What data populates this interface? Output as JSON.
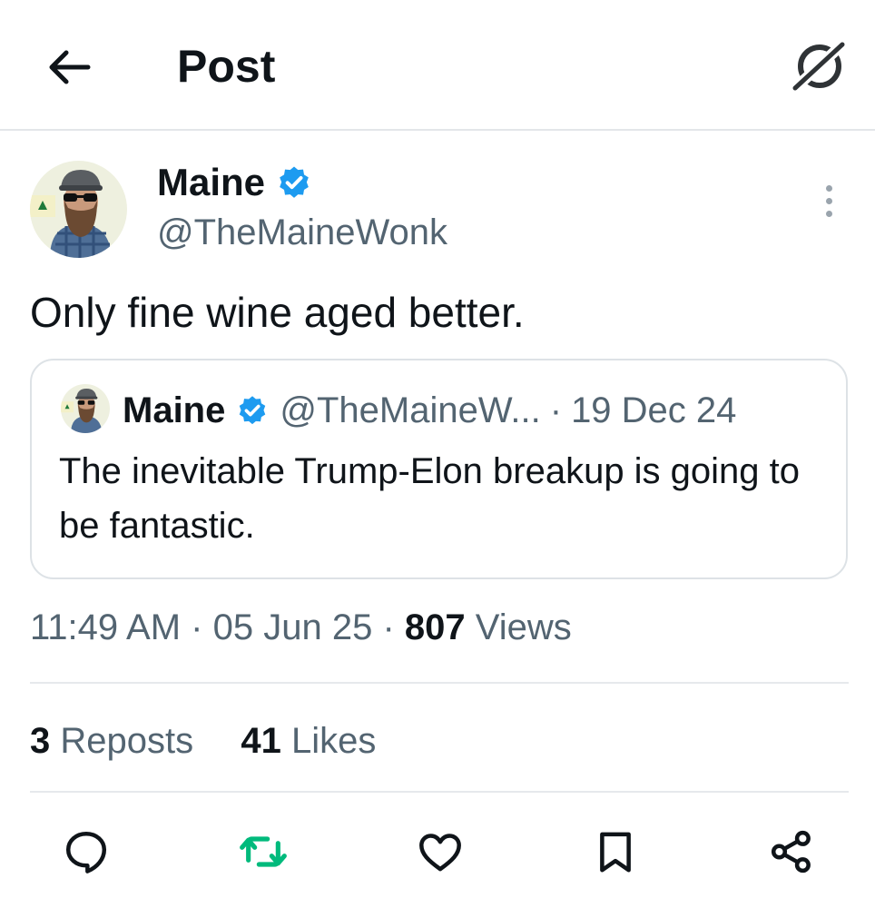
{
  "header": {
    "title": "Post",
    "back_icon": "arrow-left-icon",
    "grok_icon": "grok-icon"
  },
  "author": {
    "name": "Maine",
    "handle": "@TheMaineWonk",
    "verified": true,
    "verified_color": "#1d9bf0"
  },
  "post": {
    "text": "Only fine wine aged better."
  },
  "quote": {
    "name": "Maine",
    "handle": "@TheMaineW...",
    "separator": "·",
    "date": "19 Dec 24",
    "text": "The inevitable Trump-Elon breakup is going to be fantastic."
  },
  "meta": {
    "time": "11:49 AM",
    "separator": "·",
    "date": "05 Jun 25",
    "views_count": "807",
    "views_label": "Views"
  },
  "stats": {
    "reposts_count": "3",
    "reposts_label": "Reposts",
    "likes_count": "41",
    "likes_label": "Likes"
  },
  "actions": {
    "reply_icon": "reply-icon",
    "repost_icon": "repost-icon",
    "like_icon": "heart-icon",
    "bookmark_icon": "bookmark-icon",
    "share_icon": "share-icon",
    "repost_color": "#00ba7c"
  },
  "colors": {
    "text": "#0f1419",
    "secondary": "#536471",
    "divider": "#e6e9ec"
  }
}
